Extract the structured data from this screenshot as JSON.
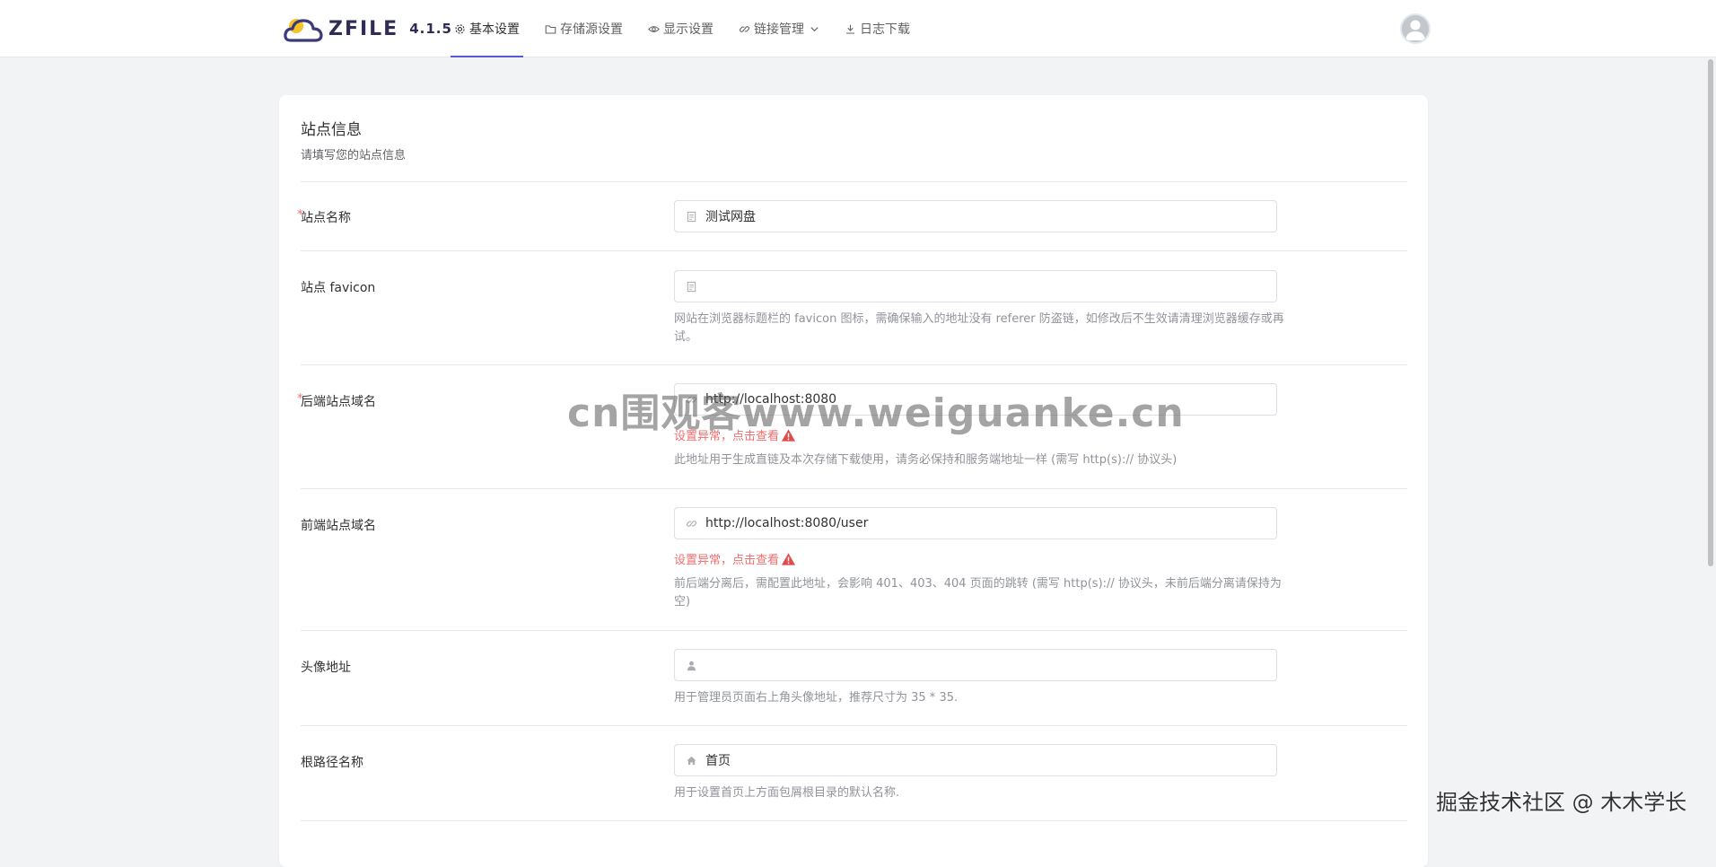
{
  "navbar": {
    "brand_name": "ZFILE",
    "brand_version": "4.1.5",
    "items": [
      {
        "label": "基本设置",
        "icon": "gear-icon",
        "active": true
      },
      {
        "label": "存储源设置",
        "icon": "folder-icon"
      },
      {
        "label": "显示设置",
        "icon": "eye-icon"
      },
      {
        "label": "链接管理",
        "icon": "link-icon"
      },
      {
        "label": "日志下载",
        "icon": "download-icon"
      }
    ]
  },
  "card": {
    "title": "站点信息",
    "subtitle": "请填写您的站点信息"
  },
  "form": {
    "site_name": {
      "label": "站点名称",
      "required": true,
      "value": "测试网盘",
      "icon": "document-icon"
    },
    "favicon": {
      "label": "站点 favicon",
      "value": "",
      "icon": "document-icon",
      "hint": "网站在浏览器标题栏的 favicon 图标，需确保输入的地址没有 referer 防盗链，如修改后不生效请清理浏览器缓存或再试。"
    },
    "backend_domain": {
      "label": "后端站点域名",
      "required": true,
      "value": "http://localhost:8080",
      "icon": "link-icon",
      "error": "设置异常，点击查看",
      "hint": "此地址用于生成直链及本次存储下载使用，请务必保持和服务端地址一样 (需写 http(s):// 协议头)"
    },
    "frontend_domain": {
      "label": "前端站点域名",
      "value": "http://localhost:8080/user",
      "icon": "link-icon",
      "error": "设置异常，点击查看",
      "hint": "前后端分离后，需配置此地址，会影响 401、403、404 页面的跳转 (需写 http(s):// 协议头，未前后端分离请保持为空)"
    },
    "avatar_url": {
      "label": "头像地址",
      "value": "",
      "icon": "user-icon",
      "hint": "用于管理员页面右上角头像地址，推荐尺寸为 35 * 35."
    },
    "root_name": {
      "label": "根路径名称",
      "value": "首页",
      "icon": "home-icon",
      "hint": "用于设置首页上方面包屑根目录的默认名称."
    }
  },
  "watermark": {
    "center": "cn围观客www.weiguanke.cn",
    "corner": "掘金技术社区 @ 木木学长"
  },
  "colors": {
    "accent": "#5b58d6",
    "error": "#f56c6c",
    "hint": "#909399",
    "background": "#f2f3f5"
  }
}
